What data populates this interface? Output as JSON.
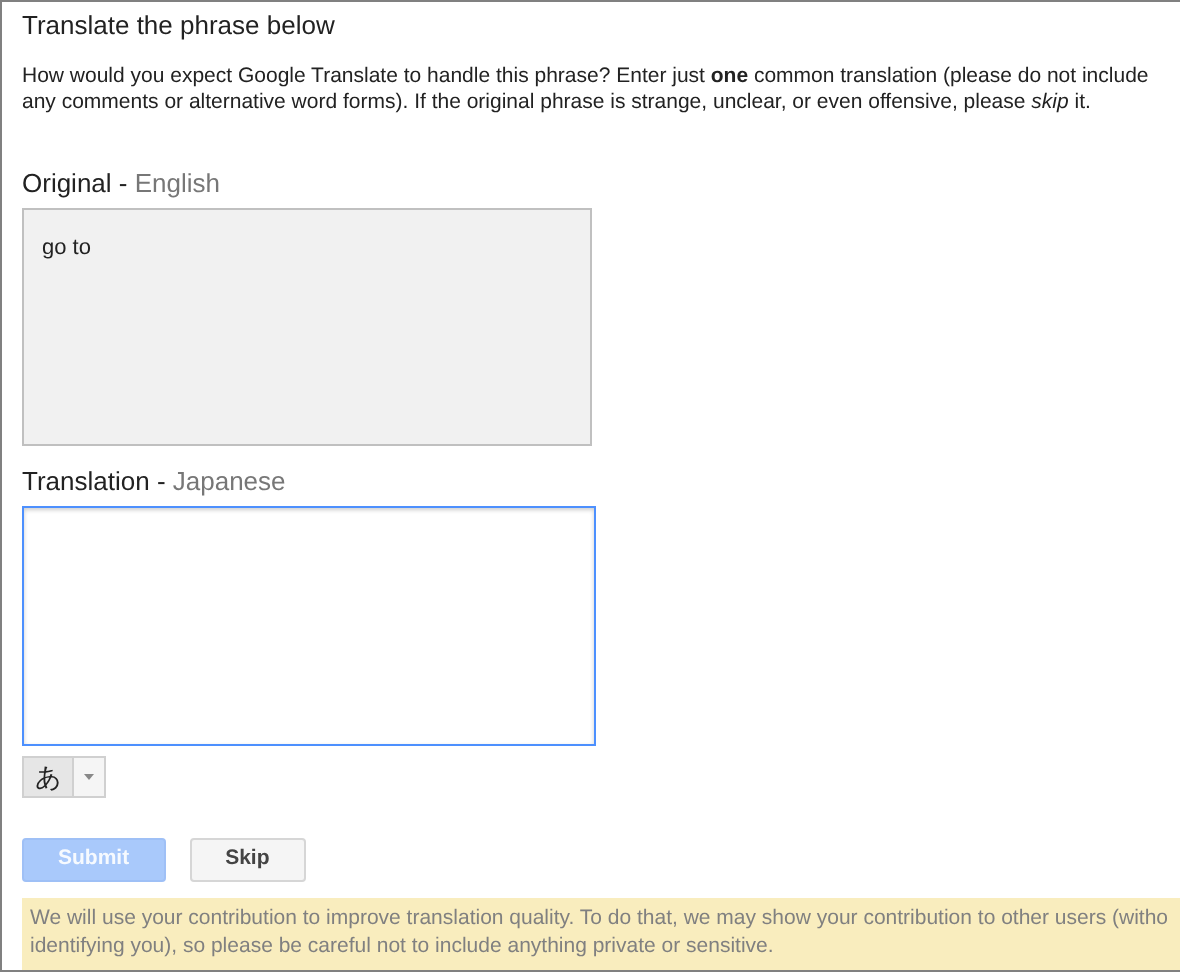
{
  "title": "Translate the phrase below",
  "instructions": "How would you expect Google Translate to handle this phrase? Enter just **one** common translation (please do not include any comments or alternative word forms). If the original phrase is strange, unclear, or even offensive, please *skip* it.",
  "original": {
    "label": "Original -",
    "language": "English",
    "text": "go to"
  },
  "translation": {
    "label": "Translation -",
    "language": "Japanese",
    "focused": true
  },
  "input_tool": {
    "label": "あ"
  },
  "buttons": [
    {
      "kind": "primary",
      "label": "Submit",
      "disabled": true
    },
    {
      "kind": "secondary",
      "label": "Skip",
      "disabled": false
    }
  ],
  "notice": [
    "We will use your contribution to improve translation quality. To do that, we may show your contribution to other users (witho",
    "identifying you), so please be careful not to include anything private or sensitive."
  ]
}
